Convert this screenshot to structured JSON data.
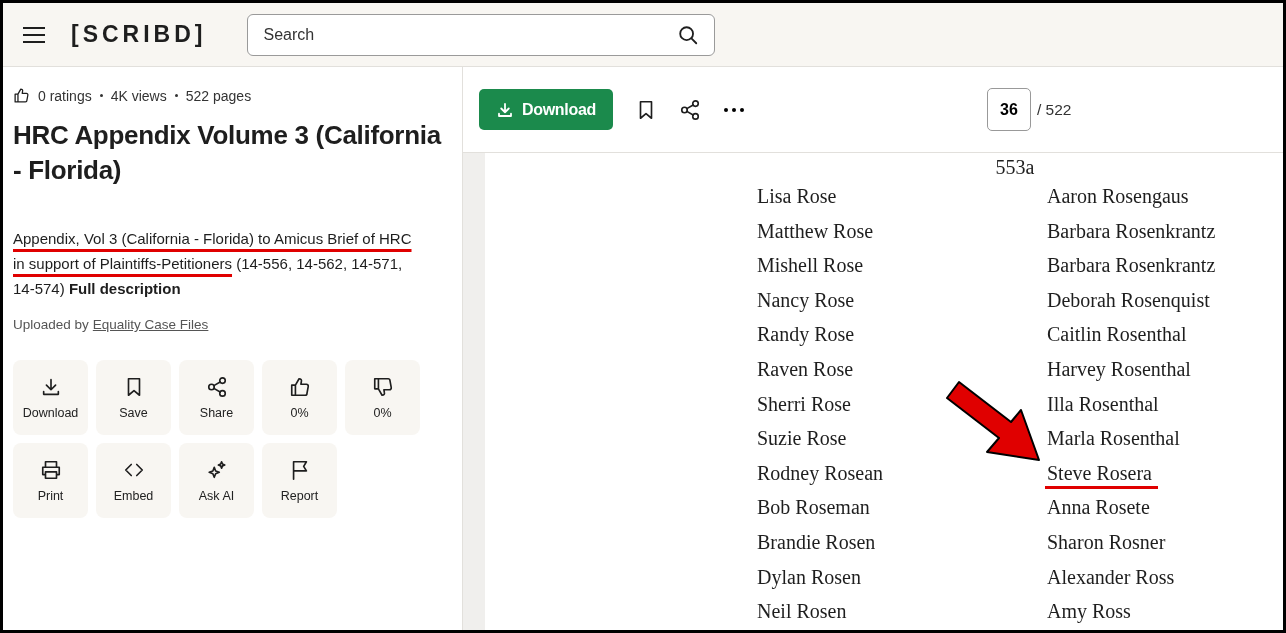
{
  "header": {
    "logo": "[SCRIBD]",
    "search": {
      "placeholder": "Search"
    }
  },
  "document": {
    "stats": [
      "0 ratings",
      "4K views",
      "522 pages"
    ],
    "title": "HRC Appendix Volume 3 (California - Florida)",
    "description": {
      "marked_text": "Appendix, Vol 3 (California - Florida) to Amicus Brief of HRC in support of Plaintiffs-Petitioners",
      "rest": " (14-556, 14-562, 14-571, 14-574) ",
      "more_link": "Full description"
    },
    "uploaded_by": {
      "label": "Uploaded by",
      "author": "Equality Case Files"
    },
    "actions": [
      {
        "kind": "download",
        "label": "Download"
      },
      {
        "kind": "save",
        "label": "Save"
      },
      {
        "kind": "share",
        "label": "Share"
      },
      {
        "kind": "like",
        "label": "0%"
      },
      {
        "kind": "dislike",
        "label": "0%"
      },
      {
        "kind": "print",
        "label": "Print"
      },
      {
        "kind": "embed",
        "label": "Embed"
      },
      {
        "kind": "ask_ai",
        "label": "Ask AI"
      },
      {
        "kind": "report",
        "label": "Report"
      }
    ]
  },
  "viewer": {
    "download_button": "Download",
    "page_number": "36",
    "page_total": "/ 522",
    "page": {
      "page_label": "553a",
      "names": [
        {
          "left": "Lisa Rose",
          "right": "Aaron Rosengaus",
          "highlighted": false
        },
        {
          "left": "Matthew Rose",
          "right": "Barbara Rosenkrantz",
          "highlighted": false
        },
        {
          "left": "Mishell Rose",
          "right": "Barbara Rosenkrantz",
          "highlighted": false
        },
        {
          "left": "Nancy Rose",
          "right": "Deborah Rosenquist",
          "highlighted": false
        },
        {
          "left": "Randy Rose",
          "right": "Caitlin Rosenthal",
          "highlighted": false
        },
        {
          "left": "Raven Rose",
          "right": "Harvey Rosenthal",
          "highlighted": false
        },
        {
          "left": "Sherri Rose",
          "right": "Illa Rosenthal",
          "highlighted": false
        },
        {
          "left": "Suzie Rose",
          "right": "Marla Rosenthal",
          "highlighted": false
        },
        {
          "left": "Rodney Rosean",
          "right": "Steve Rosera",
          "highlighted": true
        },
        {
          "left": "Bob Roseman",
          "right": "Anna Rosete",
          "highlighted": false
        },
        {
          "left": "Brandie Rosen",
          "right": "Sharon Rosner",
          "highlighted": false
        },
        {
          "left": "Dylan Rosen",
          "right": "Alexander Ross",
          "highlighted": false
        },
        {
          "left": "Neil Rosen",
          "right": "Amy Ross",
          "highlighted": false
        }
      ]
    }
  }
}
